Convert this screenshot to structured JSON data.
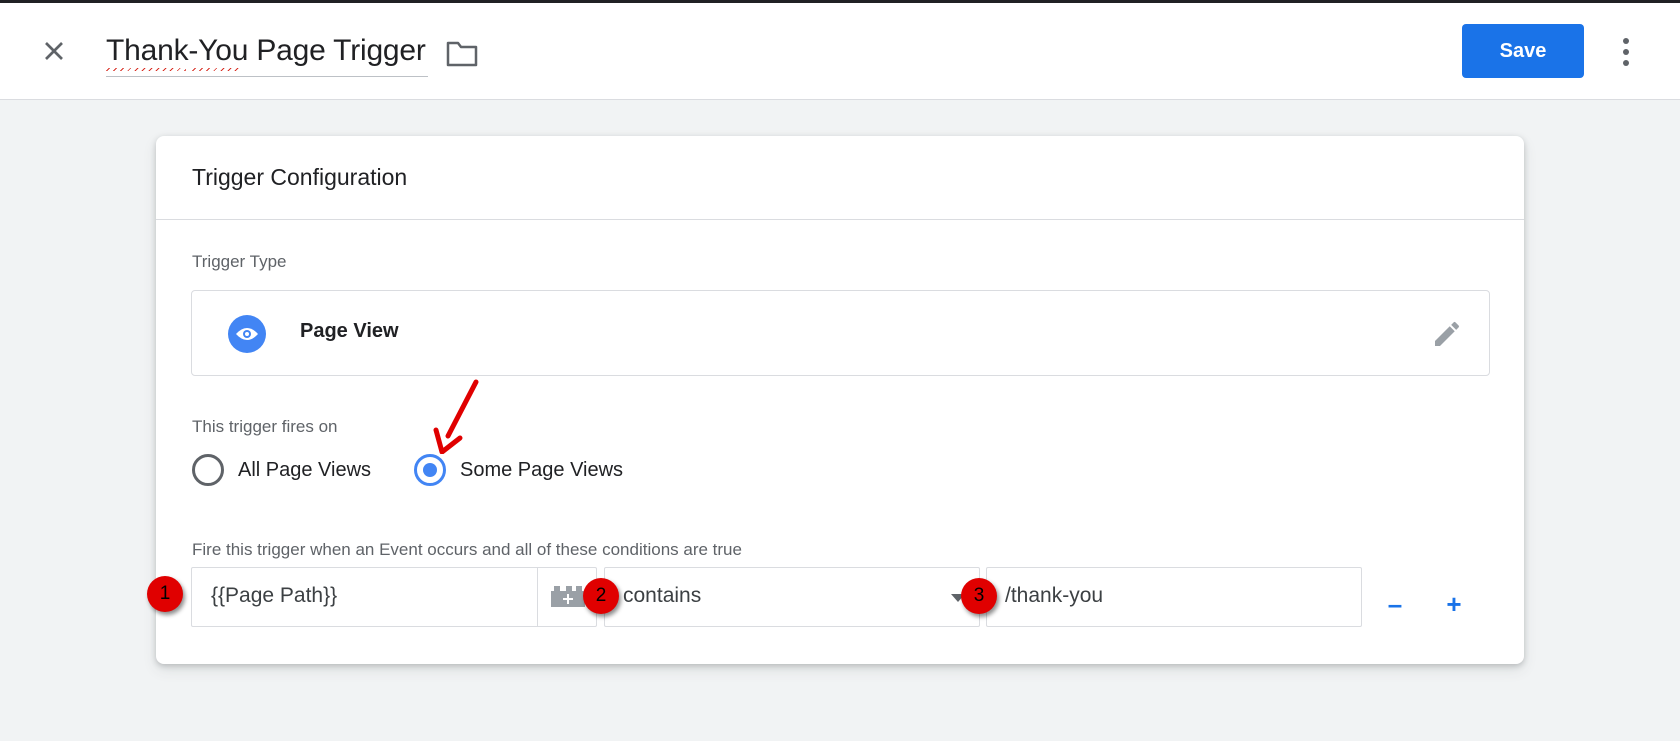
{
  "header": {
    "title": "Thank-You Page Trigger",
    "save_label": "Save"
  },
  "card": {
    "title": "Trigger Configuration",
    "trigger_type_label": "Trigger Type",
    "trigger_type_name": "Page View",
    "fires_on_label": "This trigger fires on",
    "radio_options": [
      {
        "label": "All Page Views",
        "selected": false
      },
      {
        "label": "Some Page Views",
        "selected": true
      }
    ],
    "condition_label": "Fire this trigger when an Event occurs and all of these conditions are true",
    "condition": {
      "variable": "{{Page Path}}",
      "operator": "contains",
      "value": "/thank-you"
    },
    "remove_label": "–",
    "add_label": "+"
  },
  "annotations": {
    "badges": [
      "1",
      "2",
      "3"
    ]
  },
  "colors": {
    "accent": "#1a73e8",
    "radio_on": "#4285f4",
    "annotation_red": "#e00000"
  },
  "icons": [
    "close-icon",
    "folder-icon",
    "more-vert-icon",
    "eye-icon",
    "pencil-icon",
    "variable-icon",
    "dropdown-arrow-icon"
  ]
}
